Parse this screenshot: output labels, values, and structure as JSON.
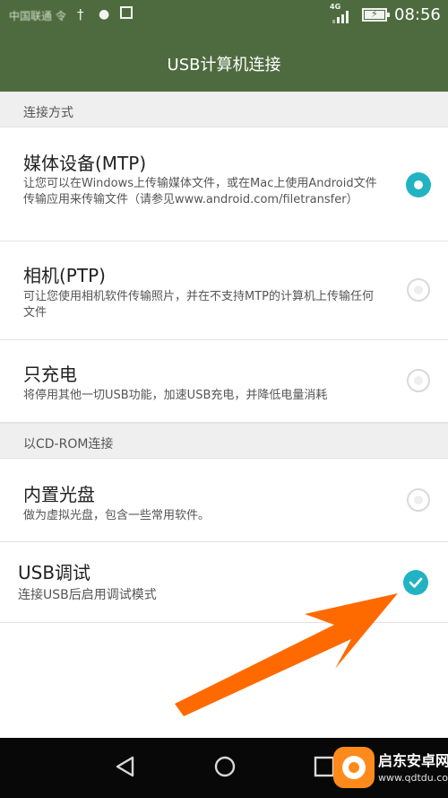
{
  "status_bar": {
    "carrier": "中国联通 令",
    "network": "4G",
    "time": "08:56",
    "icons": [
      "usb-icon",
      "debug-android-icon",
      "image-icon",
      "signal-icon",
      "battery-charging-icon"
    ]
  },
  "header": {
    "title": "USB计算机连接"
  },
  "sections": [
    {
      "header": "连接方式",
      "options": [
        {
          "title": "媒体设备(MTP)",
          "description": "让您可以在Windows上传输媒体文件，或在Mac上使用Android文件传输应用来传输文件（请参见www.android.com/filetransfer）",
          "selected": true
        },
        {
          "title": "相机(PTP)",
          "description": "可让您使用相机软件传输照片，并在不支持MTP的计算机上传输任何文件",
          "selected": false
        },
        {
          "title": "只充电",
          "description": "将停用其他一切USB功能，加速USB充电，并降低电量消耗",
          "selected": false
        }
      ]
    },
    {
      "header": "以CD-ROM连接",
      "options": [
        {
          "title": "内置光盘",
          "description": "做为虚拟光盘，包含一些常用软件。",
          "selected": false
        }
      ]
    }
  ],
  "usb_debug": {
    "title": "USB调试",
    "description": "连接USB后启用调试模式",
    "checked": true
  },
  "annotation": {
    "arrow_color": "#ff6a00"
  },
  "colors": {
    "bar": "#4e6b3f",
    "accent": "#21b3c2"
  },
  "nav_bar": {
    "buttons": [
      "back-icon",
      "home-icon",
      "recents-icon"
    ]
  },
  "watermark": {
    "name": "启东安卓网",
    "url": "www.qdtdu.com"
  }
}
